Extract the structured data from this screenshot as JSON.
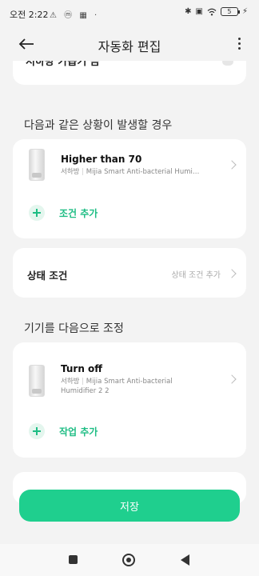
{
  "status_bar": {
    "time": "오전 2:22",
    "left_icons": "⚠ ⓜ ▦ ·",
    "battery": "5"
  },
  "header": {
    "title": "자동화 편집"
  },
  "top_card": {
    "text": "서하방 가습기 끔"
  },
  "when_section": {
    "label": "다음과 같은 상황이 발생할 경우",
    "condition": {
      "title": "Higher than 70",
      "room": "서하방",
      "device": "Mijia Smart Anti-bacterial Humi…"
    },
    "add_label": "조건 추가"
  },
  "state_condition": {
    "label": "상태 조건",
    "hint": "상태 조건 추가"
  },
  "action_section": {
    "label": "기기를 다음으로 조정",
    "action": {
      "title": "Turn off",
      "room": "서하방",
      "device": "Mijia Smart Anti-bacterial",
      "device_line2": "Humidifier 2 2"
    },
    "add_label": "작업 추가"
  },
  "save_button": "저장",
  "colors": {
    "accent": "#1ebd84",
    "save_button": "#1fcf8e",
    "background": "#f3f3f3"
  }
}
